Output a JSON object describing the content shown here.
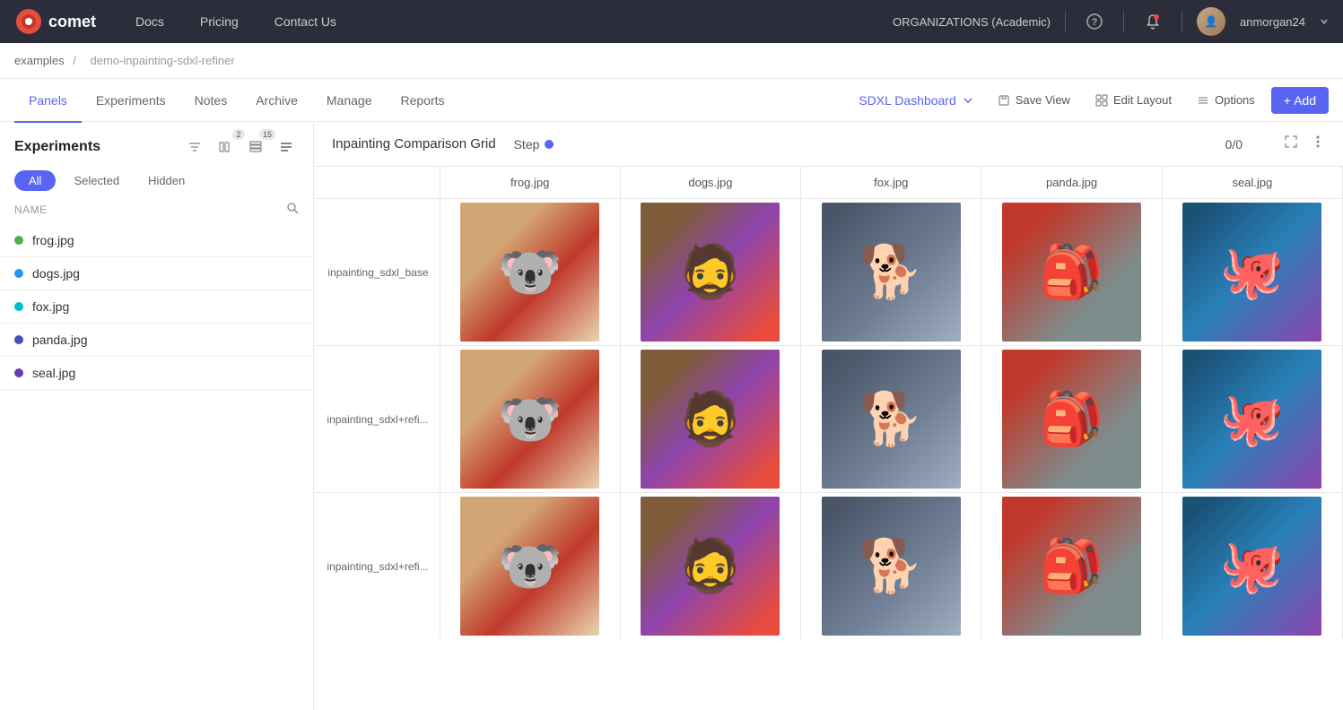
{
  "topbar": {
    "logo_text": "comet",
    "nav": [
      {
        "label": "Docs",
        "id": "docs"
      },
      {
        "label": "Pricing",
        "id": "pricing"
      },
      {
        "label": "Contact Us",
        "id": "contact"
      }
    ],
    "org_label": "ORGANIZATIONS (Academic)",
    "user_label": "anmorgan24"
  },
  "breadcrumb": {
    "parts": [
      "examples",
      "demo-inpainting-sdxl-refiner"
    ],
    "separator": "/"
  },
  "tabs": {
    "items": [
      {
        "label": "Panels",
        "id": "panels",
        "active": true
      },
      {
        "label": "Experiments",
        "id": "experiments",
        "active": false
      },
      {
        "label": "Notes",
        "id": "notes",
        "active": false
      },
      {
        "label": "Archive",
        "id": "archive",
        "active": false
      },
      {
        "label": "Manage",
        "id": "manage",
        "active": false
      },
      {
        "label": "Reports",
        "id": "reports",
        "active": false
      }
    ],
    "dashboard_label": "SDXL Dashboard",
    "save_view_label": "Save View",
    "edit_layout_label": "Edit Layout",
    "options_label": "Options",
    "add_label": "+ Add"
  },
  "sidebar": {
    "title": "Experiments",
    "filter_counts": {
      "columns": 2,
      "rows": 15
    },
    "filter_tabs": [
      "All",
      "Selected",
      "Hidden"
    ],
    "name_col_label": "NAME",
    "experiments": [
      {
        "name": "frog.jpg",
        "color": "green",
        "id": "frog"
      },
      {
        "name": "dogs.jpg",
        "color": "blue",
        "id": "dogs"
      },
      {
        "name": "fox.jpg",
        "color": "teal",
        "id": "fox"
      },
      {
        "name": "panda.jpg",
        "color": "indigo",
        "id": "panda"
      },
      {
        "name": "seal.jpg",
        "color": "purple",
        "id": "seal"
      }
    ]
  },
  "grid": {
    "title": "Inpainting Comparison Grid",
    "step_label": "Step",
    "step_range": "0/0",
    "col_headers": [
      "frog.jpg",
      "dogs.jpg",
      "fox.jpg",
      "panda.jpg",
      "seal.jpg"
    ],
    "rows": [
      {
        "label": "inpainting_sdxl_base",
        "cells": [
          {
            "type": "koala",
            "emoji": "🐨"
          },
          {
            "type": "dog-costume",
            "emoji": "🧔"
          },
          {
            "type": "bulldog",
            "emoji": "🐕"
          },
          {
            "type": "panda-obj",
            "emoji": "🎒"
          },
          {
            "type": "octopus",
            "emoji": "🐙"
          }
        ]
      },
      {
        "label": "inpainting_sdxl+refi...",
        "cells": [
          {
            "type": "koala",
            "emoji": "🐨"
          },
          {
            "type": "dog-costume",
            "emoji": "🧔"
          },
          {
            "type": "bulldog",
            "emoji": "🐕"
          },
          {
            "type": "panda-obj",
            "emoji": "🎒"
          },
          {
            "type": "octopus",
            "emoji": "🐙"
          }
        ]
      },
      {
        "label": "inpainting_sdxl+refi...",
        "cells": [
          {
            "type": "koala",
            "emoji": "🐨"
          },
          {
            "type": "dog-costume",
            "emoji": "🧔"
          },
          {
            "type": "bulldog",
            "emoji": "🐕"
          },
          {
            "type": "panda-obj",
            "emoji": "🎒"
          },
          {
            "type": "octopus",
            "emoji": "🐙"
          }
        ]
      }
    ]
  }
}
